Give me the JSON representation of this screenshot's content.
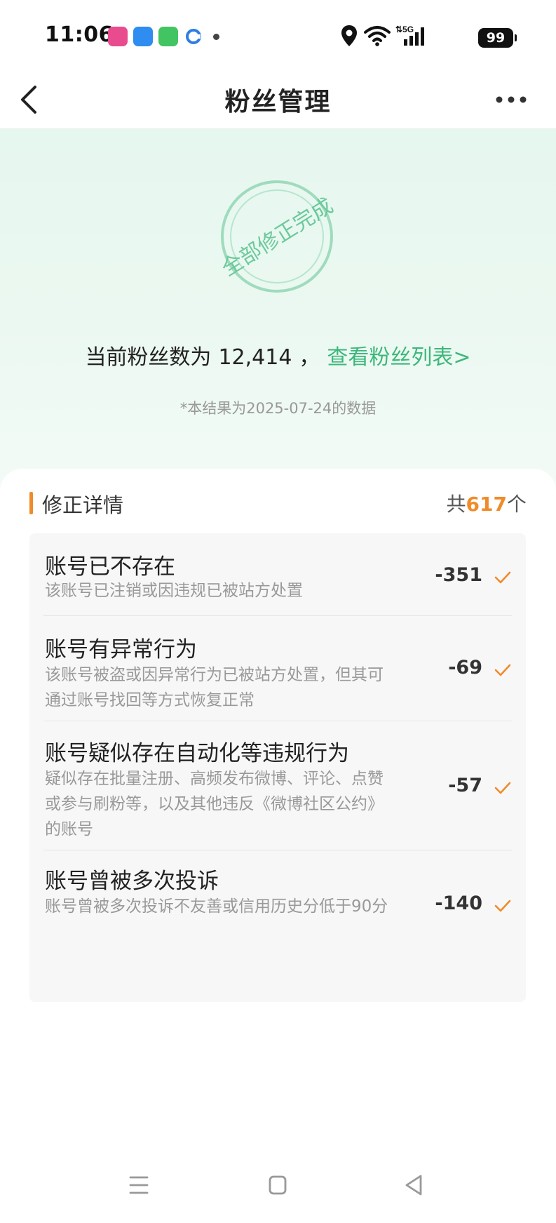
{
  "status_bar": {
    "time": "11:06",
    "battery": "99",
    "icons": [
      "app-icon",
      "app-icon",
      "message-icon",
      "app-icon",
      "dot-icon",
      "location-icon",
      "wifi-icon",
      "signal-5g-icon",
      "battery-icon"
    ]
  },
  "nav": {
    "title": "粉丝管理",
    "back_icon": "chevron-left-icon",
    "more_icon": "more-dots-icon"
  },
  "hero": {
    "stamp_text": "全部修正完成",
    "fans_prefix": "当前粉丝数为",
    "fans_count": "12,414",
    "fans_sep": "，",
    "fans_link": "查看粉丝列表>",
    "data_note": "*本结果为2025-07-24的数据"
  },
  "details": {
    "title": "修正详情",
    "count_prefix": "共",
    "count": "617",
    "count_suffix": "个",
    "items": [
      {
        "title": "账号已不存在",
        "desc": "该账号已注销或因违规已被站方处置",
        "value": "-351"
      },
      {
        "title": "账号有异常行为",
        "desc": "该账号被盗或因异常行为已被站方处置，但其可通过账号找回等方式恢复正常",
        "value": "-69"
      },
      {
        "title": "账号疑似存在自动化等违规行为",
        "desc": "疑似存在批量注册、高频发布微博、评论、点赞或参与刷粉等，以及其他违反《微博社区公约》的账号",
        "value": "-57"
      },
      {
        "title": "账号曾被多次投诉",
        "desc": "账号曾被多次投诉不友善或信用历史分低于90分",
        "value": "-140"
      }
    ]
  },
  "colors": {
    "accent_green": "#3cb77a",
    "accent_orange": "#f08b2a"
  },
  "system_nav": [
    "menu-icon",
    "home-square-icon",
    "back-triangle-icon"
  ]
}
